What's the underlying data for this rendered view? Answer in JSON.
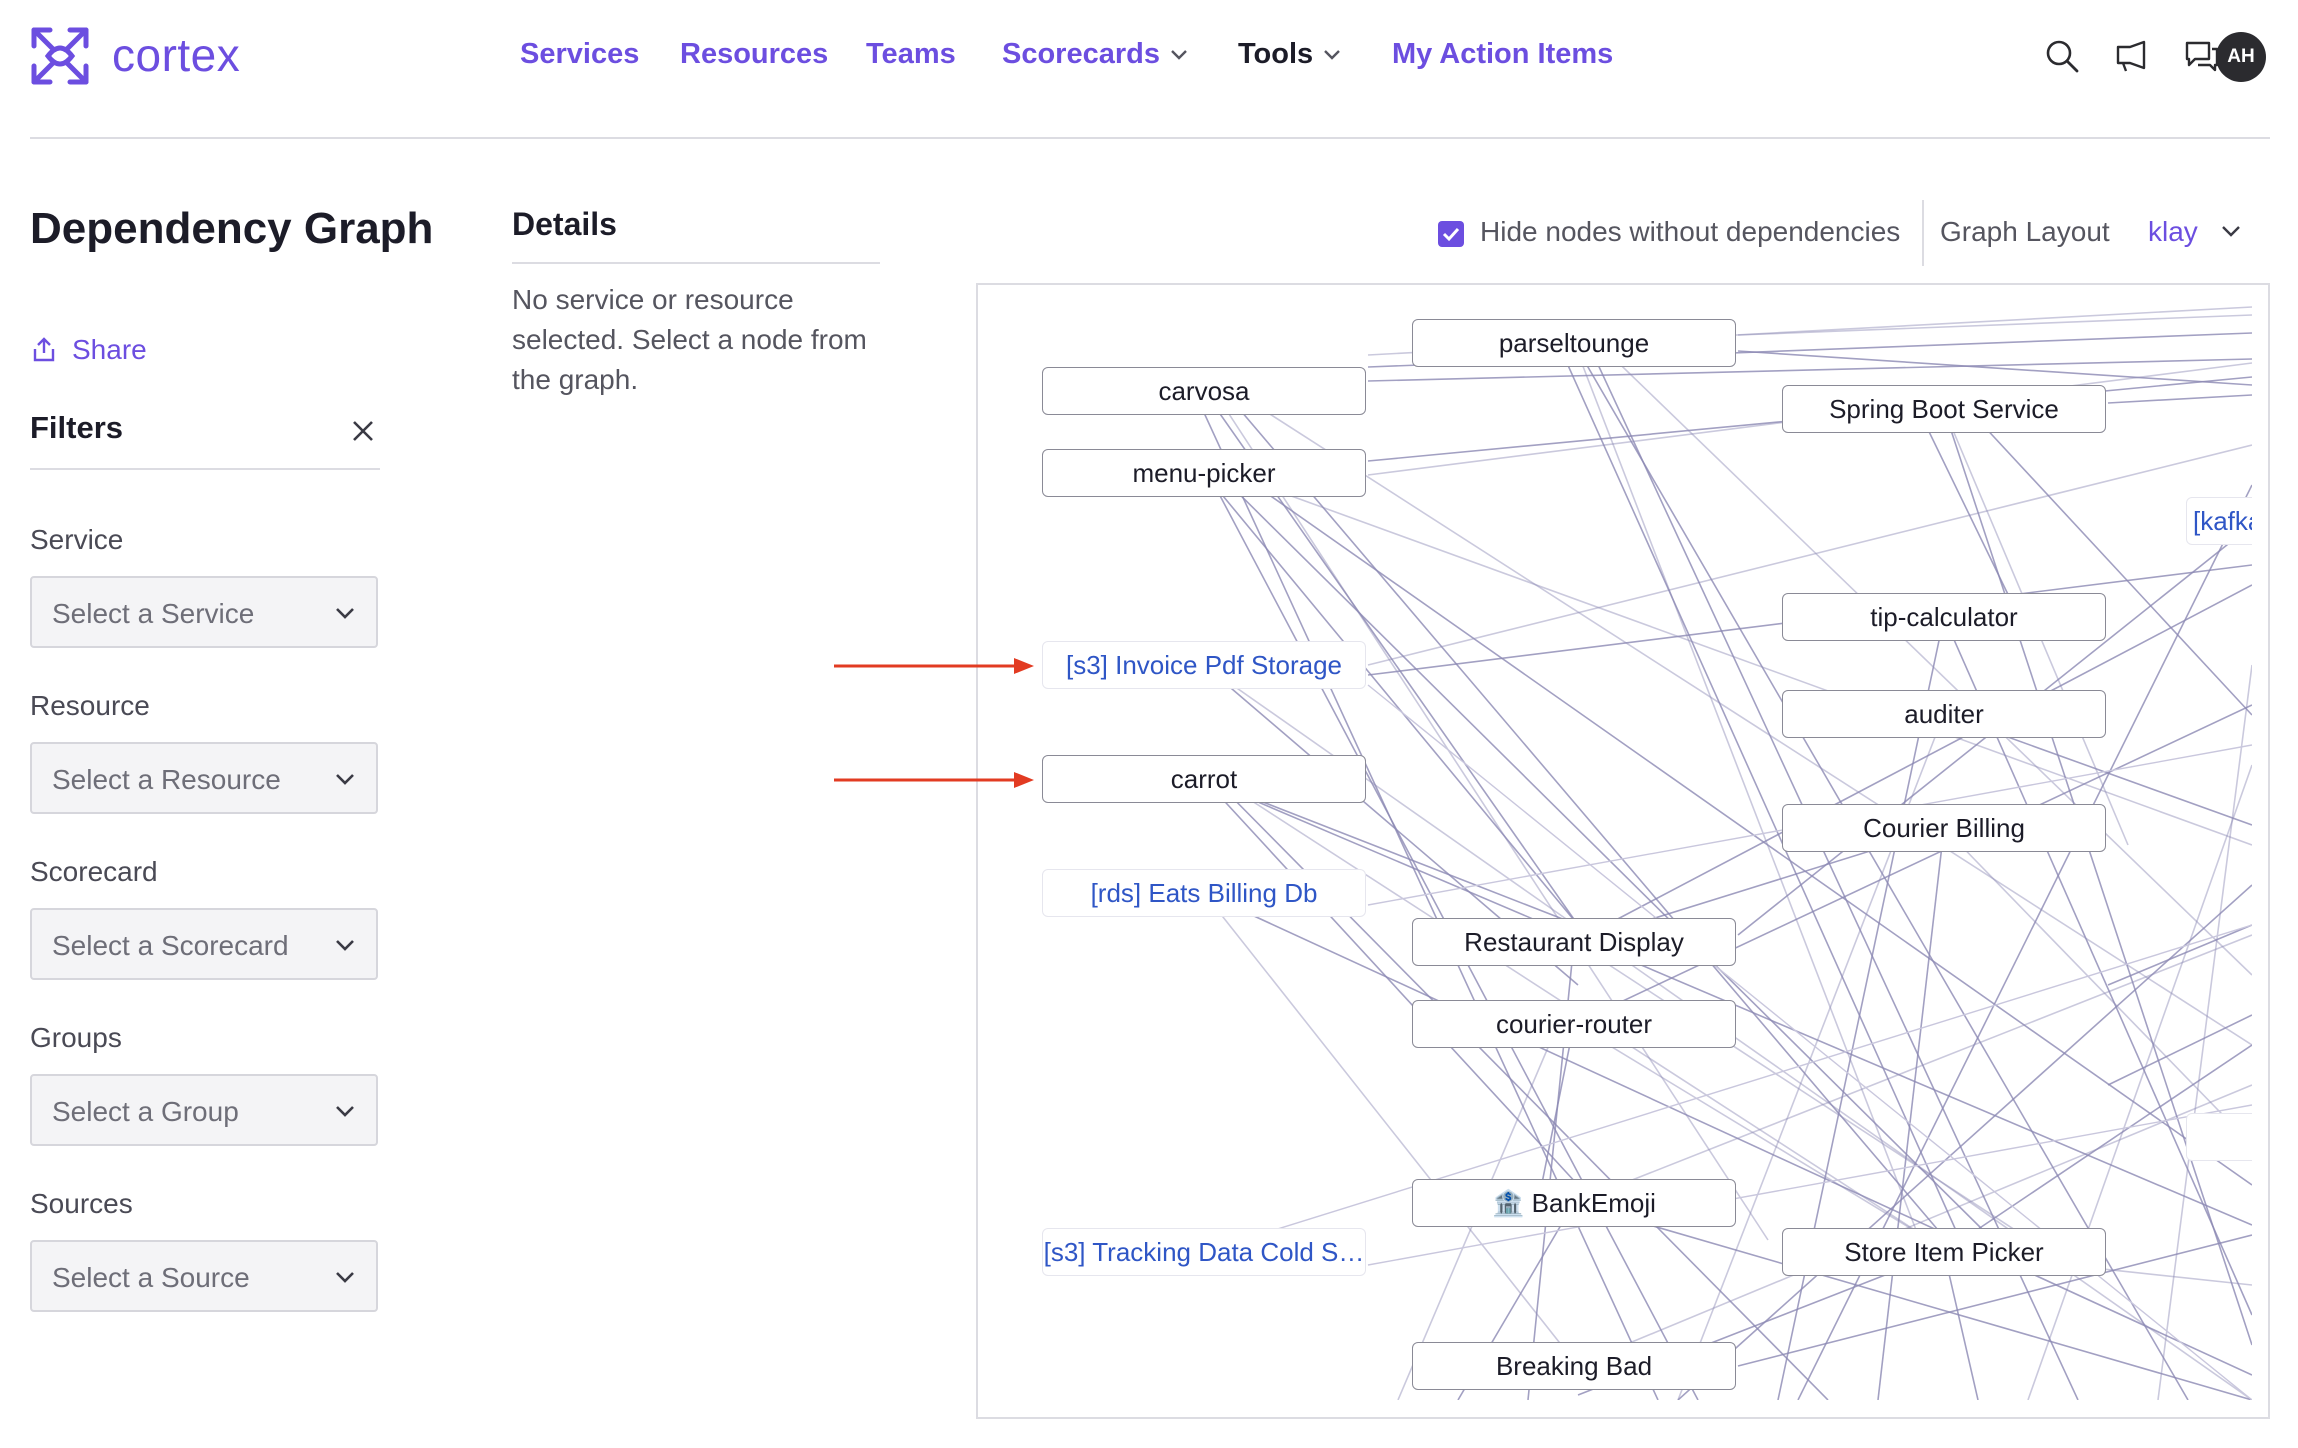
{
  "app": {
    "name": "cortex"
  },
  "nav": {
    "items": [
      {
        "label": "Services"
      },
      {
        "label": "Resources"
      },
      {
        "label": "Teams"
      },
      {
        "label": "Scorecards"
      },
      {
        "label": "Tools"
      },
      {
        "label": "My Action Items"
      }
    ]
  },
  "header_icons": [
    "search-icon",
    "megaphone-icon",
    "chat-icon"
  ],
  "user": {
    "initials": "AH"
  },
  "page": {
    "title": "Dependency Graph",
    "share_label": "Share"
  },
  "filters": {
    "title": "Filters",
    "fields": [
      {
        "label": "Service",
        "placeholder": "Select a Service"
      },
      {
        "label": "Resource",
        "placeholder": "Select a Resource"
      },
      {
        "label": "Scorecard",
        "placeholder": "Select a Scorecard"
      },
      {
        "label": "Groups",
        "placeholder": "Select a Group"
      },
      {
        "label": "Sources",
        "placeholder": "Select a Source"
      }
    ]
  },
  "details": {
    "title": "Details",
    "empty_text": "No service or resource selected. Select a node from the graph."
  },
  "graph_controls": {
    "hide_label": "Hide nodes without dependencies",
    "hide_checked": true,
    "layout_label": "Graph Layout",
    "layout_value": "klay"
  },
  "graph": {
    "nodes": {
      "parseltounge": "parseltounge",
      "carvosa": "carvosa",
      "spring": "Spring Boot Service",
      "menu": "menu-picker",
      "kafka": "[kafka-",
      "tip": "tip-calculator",
      "invoice": "[s3] Invoice Pdf Storage",
      "auditer": "auditer",
      "carrot": "carrot",
      "courierbilling": "Courier Billing",
      "eats": "[rds] Eats Billing Db",
      "restaurant": "Restaurant Display",
      "courierrouter": "courier-router",
      "partial": "[",
      "bankemoji": "BankEmoji",
      "bank_glyph": "🏦",
      "tracking": "[s3] Tracking Data Cold S…",
      "storeitem": "Store Item Picker",
      "breaking": "Breaking Bad"
    }
  },
  "colors": {
    "accent": "#6c4ee0",
    "resource_text": "#2f56c6",
    "edge": "#8c89b4",
    "annotation_arrow": "#e23b22"
  }
}
